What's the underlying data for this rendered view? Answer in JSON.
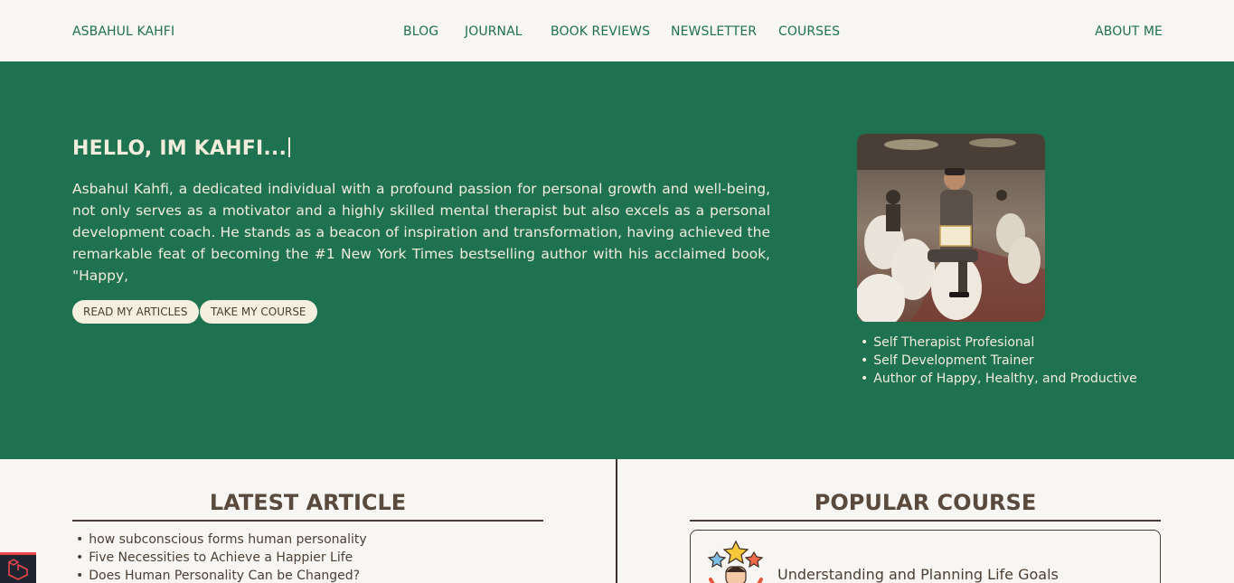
{
  "nav": {
    "brand": "ASBAHUL KAHFI",
    "links": [
      "BLOG",
      "JOURNAL",
      "BOOK REVIEWS",
      "NEWSLETTER",
      "COURSES"
    ],
    "about": "ABOUT ME"
  },
  "hero": {
    "title": "HELLO, IM KAHFI...",
    "description": "Asbahul Kahfi, a dedicated individual with a profound passion for personal growth and well-being, not only serves as a motivator and a highly skilled mental therapist but also excels as a personal development coach. He stands as a beacon of inspiration and transformation, having achieved the remarkable feat of becoming the #1 New York Times bestselling author with his acclaimed book, \"Happy,",
    "buttons": {
      "articles": "READ MY ARTICLES",
      "course": "TAKE MY COURSE"
    },
    "roles": [
      "Self Therapist Profesional",
      "Self Development Trainer",
      "Author of Happy, Healthy, and Productive"
    ]
  },
  "latest": {
    "title": "LATEST ARTICLE",
    "items": [
      "how subconscious forms human personality",
      "Five Necessities to Achieve a Happier Life",
      "Does Human Personality Can be Changed?"
    ]
  },
  "popular": {
    "title": "POPULAR COURSE",
    "course_name": "Understanding and Planning Life Goals"
  },
  "colors": {
    "primary": "#1f7250",
    "background": "#f8f6f2",
    "text": "#5a4a3e",
    "hero_text": "#f1ecdc"
  },
  "icons": {
    "badge": "laravel-icon",
    "course": "goal-stars-illustration"
  }
}
